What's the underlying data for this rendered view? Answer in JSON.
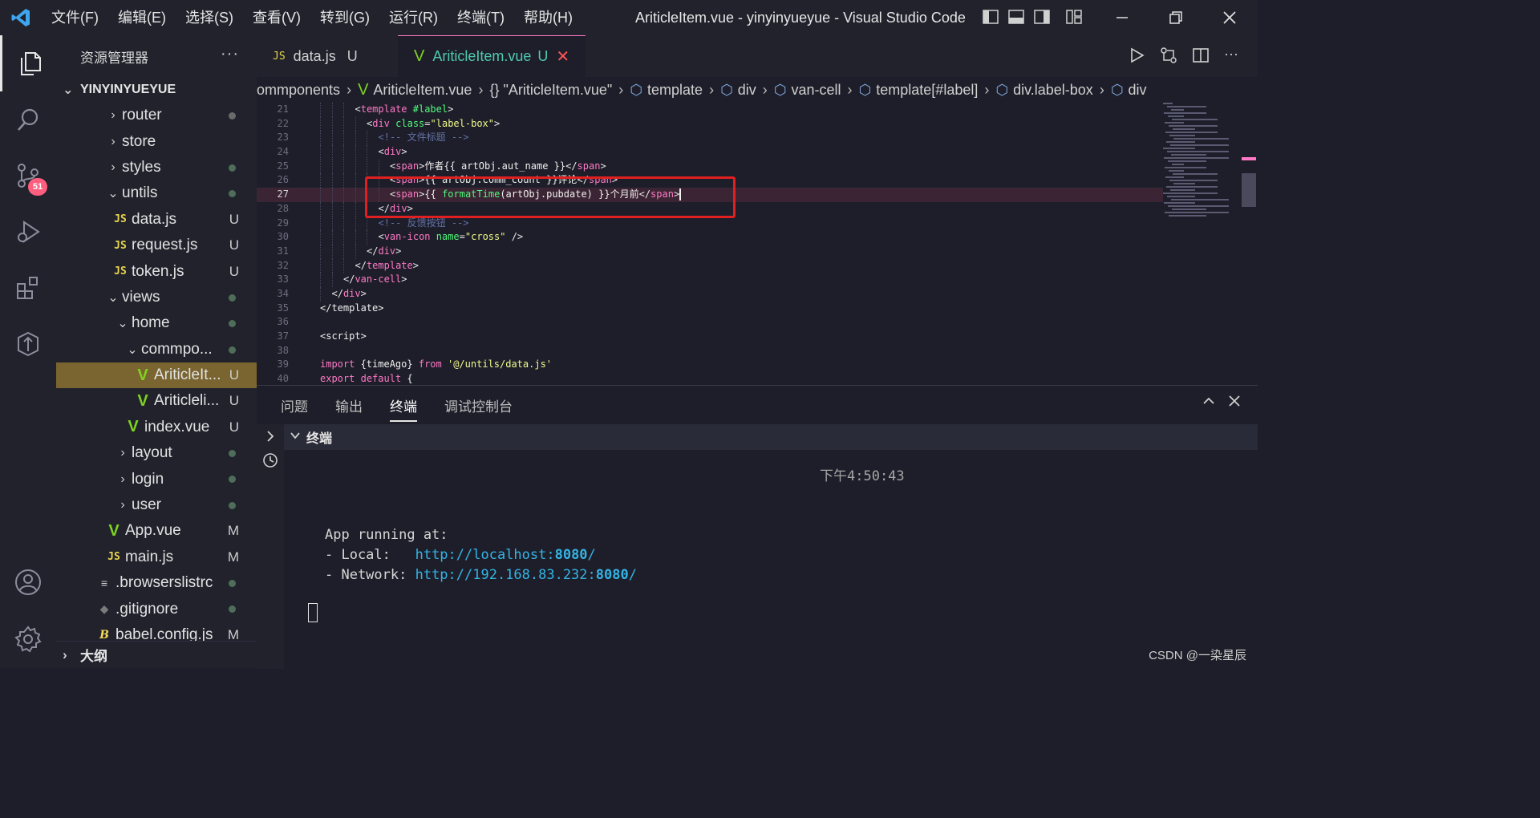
{
  "menu": [
    "文件(F)",
    "编辑(E)",
    "选择(S)",
    "查看(V)",
    "转到(G)",
    "运行(R)",
    "终端(T)",
    "帮助(H)"
  ],
  "window_title": "AriticleItem.vue - yinyinyueyue - Visual Studio Code",
  "activity": {
    "scm_badge": "51"
  },
  "sidebar": {
    "header": "资源管理器",
    "more": "···",
    "project": "YINYINYUEYUE",
    "items": [
      {
        "label": "router",
        "chev": "›",
        "icon": "",
        "status": ""
      },
      {
        "label": "store",
        "chev": "›",
        "icon": "",
        "status": ""
      },
      {
        "label": "styles",
        "chev": "›",
        "icon": "",
        "status": ""
      },
      {
        "label": "untils",
        "chev": "⌄",
        "icon": "",
        "status": ""
      },
      {
        "label": "data.js",
        "chev": "",
        "icon": "JS",
        "status": "U"
      },
      {
        "label": "request.js",
        "chev": "",
        "icon": "JS",
        "status": "U"
      },
      {
        "label": "token.js",
        "chev": "",
        "icon": "JS",
        "status": "U"
      },
      {
        "label": "views",
        "chev": "⌄",
        "icon": "",
        "status": ""
      },
      {
        "label": "home",
        "chev": "⌄",
        "icon": "",
        "status": ""
      },
      {
        "label": "commpo...",
        "chev": "⌄",
        "icon": "",
        "status": ""
      },
      {
        "label": "AriticleIt...",
        "chev": "",
        "icon": "V",
        "status": "U"
      },
      {
        "label": "Ariticleli...",
        "chev": "",
        "icon": "V",
        "status": "U"
      },
      {
        "label": "index.vue",
        "chev": "",
        "icon": "V",
        "status": "U"
      },
      {
        "label": "layout",
        "chev": "›",
        "icon": "",
        "status": ""
      },
      {
        "label": "login",
        "chev": "›",
        "icon": "",
        "status": ""
      },
      {
        "label": "user",
        "chev": "›",
        "icon": "",
        "status": ""
      },
      {
        "label": "App.vue",
        "chev": "",
        "icon": "V",
        "status": "M"
      },
      {
        "label": "main.js",
        "chev": "",
        "icon": "JS",
        "status": "M"
      },
      {
        "label": ".browserslistrc",
        "chev": "",
        "icon": "≡",
        "status": ""
      },
      {
        "label": ".gitignore",
        "chev": "",
        "icon": "◆",
        "status": ""
      },
      {
        "label": "babel.config.js",
        "chev": "",
        "icon": "B",
        "status": "M"
      }
    ],
    "outline": "大纲"
  },
  "tabs": [
    {
      "icon": "JS",
      "label": "data.js",
      "status": "U"
    },
    {
      "icon": "V",
      "label": "AriticleItem.vue",
      "status": "U",
      "close": "✕"
    }
  ],
  "breadcrumb": [
    "ommponents",
    "AriticleItem.vue",
    "{} \"AriticleItem.vue\"",
    "template",
    "div",
    "van-cell",
    "template[#label]",
    "div.label-box",
    "div"
  ],
  "code": {
    "line_numbers": [
      "21",
      "22",
      "23",
      "24",
      "25",
      "26",
      "27",
      "28",
      "29",
      "30",
      "31",
      "32",
      "33",
      "34",
      "35",
      "36",
      "37",
      "38",
      "39",
      "40"
    ],
    "l21": [
      "<",
      "template",
      " #label",
      ">"
    ],
    "l22": [
      "<",
      "div",
      " class",
      "=",
      "\"label-box\"",
      ">"
    ],
    "l23": "<!-- 文件标题 -->",
    "l24": [
      "<",
      "div",
      ">"
    ],
    "l25": [
      "<",
      "span",
      ">",
      "作者{{ artObj.aut_name }}",
      "</",
      "span",
      ">"
    ],
    "l26": [
      "<",
      "span",
      ">",
      "{{ artObj.comm_count }}评论",
      "</",
      "span",
      ">"
    ],
    "l27": [
      "<",
      "span",
      ">",
      "{{ ",
      "formatTime",
      "(artObj.pubdate) }}个月前",
      "</",
      "span",
      ">"
    ],
    "l28": [
      "</",
      "div",
      ">"
    ],
    "l29": "<!-- 反馈按钮 -->",
    "l30": [
      "<",
      "van-icon",
      " name",
      "=",
      "\"cross\"",
      " />"
    ],
    "l31": [
      "</",
      "div",
      ">"
    ],
    "l32": [
      "</",
      "template",
      ">"
    ],
    "l33": [
      "</",
      "van-cell",
      ">"
    ],
    "l34": [
      "</",
      "div",
      ">"
    ],
    "l35": "</template>",
    "l37": "<script>",
    "l39": [
      "import",
      " {timeAgo} ",
      "from",
      " '@/untils/data.js'"
    ],
    "l40": [
      "export",
      " ",
      "default",
      " {"
    ]
  },
  "panel": {
    "tabs": [
      "问题",
      "输出",
      "终端",
      "调试控制台"
    ],
    "terminal_title": "终端",
    "time": "下午4:50:43",
    "running": "App running at:",
    "local_label": "- Local:   ",
    "local_url": "http://localhost:",
    "local_port": "8080",
    "network_label": "- Network: ",
    "network_url": "http://192.168.83.232:",
    "network_port": "8080",
    "slash": "/"
  },
  "watermark": "CSDN @一染星辰"
}
